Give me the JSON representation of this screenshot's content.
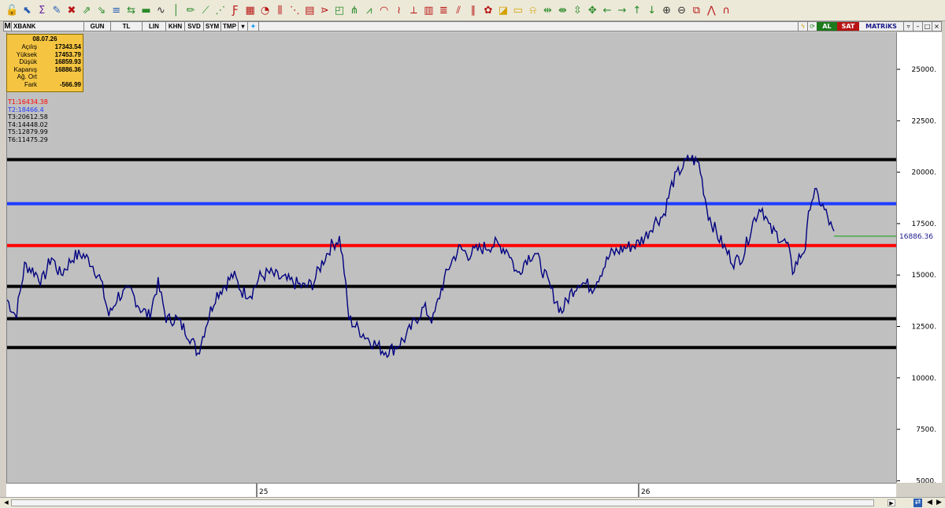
{
  "toolbar": {
    "icons": [
      {
        "name": "lock-icon",
        "glyph": "🔓",
        "color": "#2a8a2a"
      },
      {
        "name": "arrow-cursor-icon",
        "glyph": "⬉",
        "color": "#2a5fb4"
      },
      {
        "name": "formula-icon",
        "glyph": "Σ",
        "color": "#6b2aa0"
      },
      {
        "name": "draw-line-icon",
        "glyph": "✎",
        "color": "#2a5fb4"
      },
      {
        "name": "cross-tools-icon",
        "glyph": "✖",
        "color": "#b81414"
      },
      {
        "name": "trend-up-icon",
        "glyph": "⇗",
        "color": "#2a8a2a"
      },
      {
        "name": "trend-down-icon",
        "glyph": "⇘",
        "color": "#2a8a2a"
      },
      {
        "name": "horizontal-lines-icon",
        "glyph": "≡",
        "color": "#2a5fb4"
      },
      {
        "name": "double-arrow-icon",
        "glyph": "⇆",
        "color": "#2a8a2a"
      },
      {
        "name": "single-line-icon",
        "glyph": "▬",
        "color": "#2a8a2a"
      },
      {
        "name": "vsin-icon",
        "glyph": "∿",
        "color": "#333333"
      },
      {
        "name": "vertical-line-icon",
        "glyph": "│",
        "color": "#2a8a2a"
      },
      {
        "name": "pencil-icon",
        "glyph": "✏",
        "color": "#2a8a2a"
      },
      {
        "name": "channel-icon",
        "glyph": "⟋",
        "color": "#2a8a2a"
      },
      {
        "name": "fan-icon",
        "glyph": "⋰",
        "color": "#2a8a2a"
      },
      {
        "name": "fibonacci-icon",
        "glyph": "Ƒ",
        "color": "#b81414"
      },
      {
        "name": "grid-icon",
        "glyph": "▦",
        "color": "#b81414"
      },
      {
        "name": "arcs-icon",
        "glyph": "◔",
        "color": "#b81414"
      },
      {
        "name": "timezones-icon",
        "glyph": "⫼",
        "color": "#b81414"
      },
      {
        "name": "fib-fan-icon",
        "glyph": "⋱",
        "color": "#b81414"
      },
      {
        "name": "fib-grid-icon",
        "glyph": "▤",
        "color": "#b81414"
      },
      {
        "name": "gann-icon",
        "glyph": "⋗",
        "color": "#b81414"
      },
      {
        "name": "gann-box-icon",
        "glyph": "◰",
        "color": "#2a8a2a"
      },
      {
        "name": "andrews-icon",
        "glyph": "⋔",
        "color": "#2a8a2a"
      },
      {
        "name": "speed-lines-icon",
        "glyph": "⩘",
        "color": "#2a8a2a"
      },
      {
        "name": "cycle-icon",
        "glyph": "◠",
        "color": "#b81414"
      },
      {
        "name": "wave-icon",
        "glyph": "≀",
        "color": "#b81414"
      },
      {
        "name": "regression-icon",
        "glyph": "⟂",
        "color": "#b81414"
      },
      {
        "name": "table-icon",
        "glyph": "▥",
        "color": "#b81414"
      },
      {
        "name": "text-icon",
        "glyph": "≣",
        "color": "#b81414"
      },
      {
        "name": "ruler-icon",
        "glyph": "⫽",
        "color": "#b81414"
      },
      {
        "name": "parallel-lines-icon",
        "glyph": "∥",
        "color": "#b81414"
      },
      {
        "name": "palette-icon",
        "glyph": "✿",
        "color": "#b81414"
      },
      {
        "name": "label-icon",
        "glyph": "◪",
        "color": "#d4a000"
      },
      {
        "name": "note-icon",
        "glyph": "▭",
        "color": "#d4a000"
      },
      {
        "name": "bell-icon",
        "glyph": "⍾",
        "color": "#d4a000"
      },
      {
        "name": "expand-horizontal-icon",
        "glyph": "⇹",
        "color": "#2a8a2a"
      },
      {
        "name": "shrink-horizontal-icon",
        "glyph": "⇼",
        "color": "#2a8a2a"
      },
      {
        "name": "expand-vertical-icon",
        "glyph": "⇳",
        "color": "#2a8a2a"
      },
      {
        "name": "fit-icon",
        "glyph": "✥",
        "color": "#2a8a2a"
      },
      {
        "name": "arrow-left-icon",
        "glyph": "←",
        "color": "#2a8a2a"
      },
      {
        "name": "arrow-right-icon",
        "glyph": "→",
        "color": "#2a8a2a"
      },
      {
        "name": "arrow-up-icon",
        "glyph": "↑",
        "color": "#2a8a2a"
      },
      {
        "name": "arrow-down-icon",
        "glyph": "↓",
        "color": "#2a8a2a"
      },
      {
        "name": "zoom-in-icon",
        "glyph": "⊕",
        "color": "#333333"
      },
      {
        "name": "zoom-out-icon",
        "glyph": "⊖",
        "color": "#333333"
      },
      {
        "name": "snapshot-icon",
        "glyph": "⧉",
        "color": "#b81414"
      },
      {
        "name": "zigzag-icon",
        "glyph": "⋀",
        "color": "#b81414"
      },
      {
        "name": "magnet-icon",
        "glyph": "∩",
        "color": "#b81414"
      }
    ]
  },
  "header": {
    "symbol": "XBANK",
    "period": "GUN",
    "currency": "TL",
    "scale": "LIN",
    "tabs": [
      "KHN",
      "SVD",
      "SYM",
      "TMP"
    ],
    "buy": "AL",
    "sell": "SAT",
    "brand": "MATRiKS"
  },
  "info_box": {
    "date": "08.07.26",
    "rows": [
      {
        "label": "Açılış",
        "value": "17343.54"
      },
      {
        "label": "Yüksek",
        "value": "17453.79"
      },
      {
        "label": "Düşük",
        "value": "16859.93"
      },
      {
        "label": "Kapanış",
        "value": "16886.36"
      },
      {
        "label": "Ağ. Ort",
        "value": ""
      },
      {
        "label": "Fark",
        "value": "-566.99"
      }
    ]
  },
  "targets": [
    {
      "label": "T1:16434.38",
      "color": "#ff0000"
    },
    {
      "label": "T2:18466.4",
      "color": "#1e3cff"
    },
    {
      "label": "T3:20612.58",
      "color": "#000000"
    },
    {
      "label": "T4:14448.02",
      "color": "#000000"
    },
    {
      "label": "T5:12879.99",
      "color": "#000000"
    },
    {
      "label": "T6:11475.29",
      "color": "#000000"
    }
  ],
  "chart_data": {
    "type": "line",
    "y_ticks": [
      "25000.",
      "22500.",
      "20000.",
      "17500.",
      "15000.",
      "12500.",
      "10000.",
      "7500.",
      "5000."
    ],
    "x_ticks": [
      "25",
      "26"
    ],
    "last_price": "16886.36",
    "ylim": [
      4900,
      26800
    ],
    "levels": [
      {
        "name": "T1",
        "value": 16434.38,
        "color": "#ff0000"
      },
      {
        "name": "T2",
        "value": 18466.4,
        "color": "#1e3cff"
      },
      {
        "name": "T3",
        "value": 20612.58,
        "color": "#000000"
      },
      {
        "name": "T4",
        "value": 14448.02,
        "color": "#000000"
      },
      {
        "name": "T5",
        "value": 12879.99,
        "color": "#000000"
      },
      {
        "name": "T6",
        "value": 11475.29,
        "color": "#000000"
      }
    ],
    "series_color": "#000080",
    "price_path": [
      [
        0,
        13800
      ],
      [
        0.01,
        13000
      ],
      [
        0.02,
        15500
      ],
      [
        0.03,
        15200
      ],
      [
        0.04,
        14700
      ],
      [
        0.05,
        15900
      ],
      [
        0.06,
        15000
      ],
      [
        0.075,
        15900
      ],
      [
        0.085,
        16000
      ],
      [
        0.095,
        15600
      ],
      [
        0.105,
        14800
      ],
      [
        0.115,
        13000
      ],
      [
        0.125,
        14000
      ],
      [
        0.14,
        14200
      ],
      [
        0.15,
        13400
      ],
      [
        0.16,
        13000
      ],
      [
        0.17,
        14600
      ],
      [
        0.18,
        12800
      ],
      [
        0.19,
        12900
      ],
      [
        0.205,
        12100
      ],
      [
        0.215,
        11200
      ],
      [
        0.225,
        12700
      ],
      [
        0.235,
        14000
      ],
      [
        0.245,
        14500
      ],
      [
        0.255,
        15000
      ],
      [
        0.265,
        14200
      ],
      [
        0.275,
        14100
      ],
      [
        0.285,
        14900
      ],
      [
        0.295,
        15100
      ],
      [
        0.31,
        14800
      ],
      [
        0.325,
        14600
      ],
      [
        0.335,
        14400
      ],
      [
        0.345,
        14600
      ],
      [
        0.355,
        15600
      ],
      [
        0.365,
        16400
      ],
      [
        0.375,
        16800
      ],
      [
        0.38,
        15200
      ],
      [
        0.385,
        12900
      ],
      [
        0.395,
        12400
      ],
      [
        0.41,
        11800
      ],
      [
        0.425,
        11300
      ],
      [
        0.435,
        11400
      ],
      [
        0.45,
        12000
      ],
      [
        0.46,
        12800
      ],
      [
        0.47,
        13400
      ],
      [
        0.48,
        12800
      ],
      [
        0.49,
        14400
      ],
      [
        0.5,
        15600
      ],
      [
        0.51,
        16300
      ],
      [
        0.52,
        16000
      ],
      [
        0.535,
        16300
      ],
      [
        0.55,
        16500
      ],
      [
        0.565,
        16200
      ],
      [
        0.575,
        15000
      ],
      [
        0.585,
        15800
      ],
      [
        0.595,
        16100
      ],
      [
        0.605,
        15100
      ],
      [
        0.615,
        14100
      ],
      [
        0.625,
        13200
      ],
      [
        0.635,
        14100
      ],
      [
        0.645,
        14700
      ],
      [
        0.66,
        14400
      ],
      [
        0.67,
        15200
      ],
      [
        0.68,
        16000
      ],
      [
        0.695,
        16300
      ],
      [
        0.71,
        16500
      ],
      [
        0.72,
        16900
      ],
      [
        0.73,
        17600
      ],
      [
        0.74,
        17900
      ],
      [
        0.75,
        19500
      ],
      [
        0.76,
        20200
      ],
      [
        0.77,
        20700
      ],
      [
        0.78,
        20400
      ],
      [
        0.79,
        18000
      ],
      [
        0.8,
        17000
      ],
      [
        0.81,
        16200
      ],
      [
        0.82,
        15600
      ],
      [
        0.83,
        16000
      ],
      [
        0.84,
        17500
      ],
      [
        0.85,
        18400
      ],
      [
        0.86,
        17200
      ],
      [
        0.87,
        16900
      ],
      [
        0.88,
        16400
      ],
      [
        0.885,
        15200
      ],
      [
        0.89,
        15600
      ],
      [
        0.9,
        16400
      ],
      [
        0.905,
        18500
      ],
      [
        0.91,
        19000
      ],
      [
        0.915,
        18700
      ],
      [
        0.925,
        17800
      ],
      [
        0.932,
        16900
      ]
    ]
  }
}
